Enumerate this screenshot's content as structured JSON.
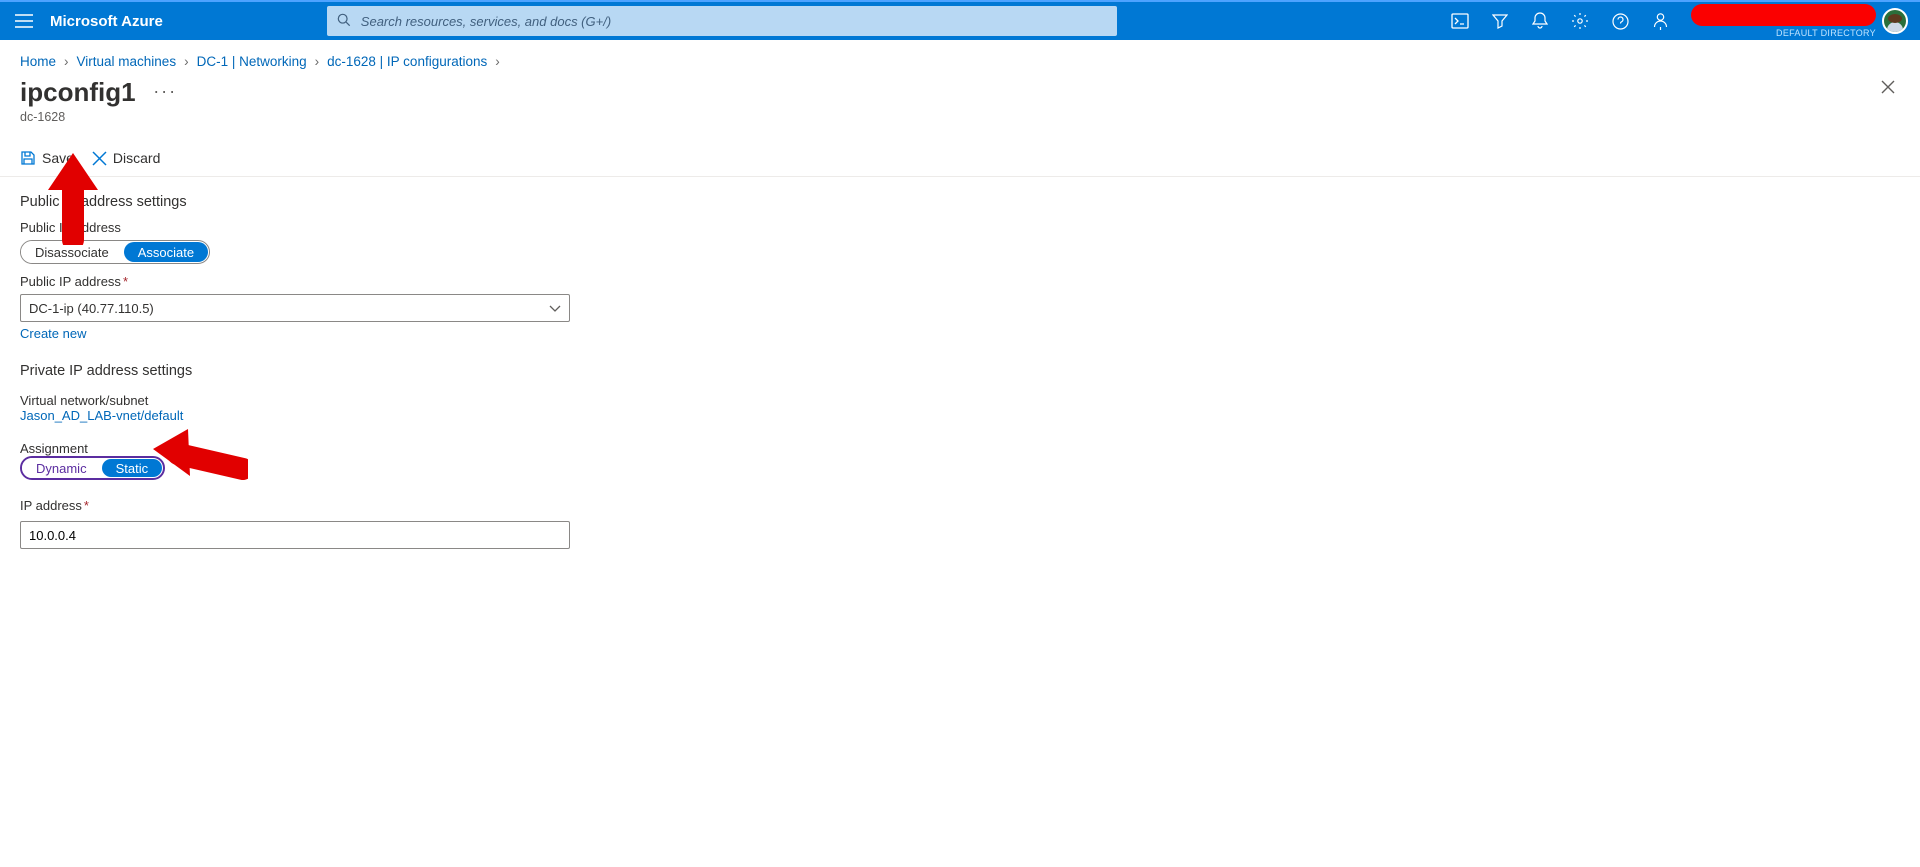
{
  "header": {
    "brand": "Microsoft Azure",
    "search_placeholder": "Search resources, services, and docs (G+/)",
    "directory_label": "DEFAULT DIRECTORY"
  },
  "breadcrumbs": [
    "Home",
    "Virtual machines",
    "DC-1 | Networking",
    "dc-1628 | IP configurations"
  ],
  "page": {
    "title": "ipconfig1",
    "subtitle": "dc-1628"
  },
  "toolbar": {
    "save_label": "Save",
    "discard_label": "Discard"
  },
  "public_ip": {
    "section_title": "Public IP address settings",
    "toggle_label": "Public IP address",
    "disassociate": "Disassociate",
    "associate": "Associate",
    "dropdown_label": "Public IP address",
    "dropdown_value": "DC-1-ip (40.77.110.5)",
    "create_new": "Create new"
  },
  "private_ip": {
    "section_title": "Private IP address settings",
    "vnet_label": "Virtual network/subnet",
    "vnet_link": "Jason_AD_LAB-vnet/default",
    "assignment_label": "Assignment",
    "dynamic": "Dynamic",
    "static": "Static",
    "ip_label": "IP address",
    "ip_value": "10.0.0.4"
  }
}
